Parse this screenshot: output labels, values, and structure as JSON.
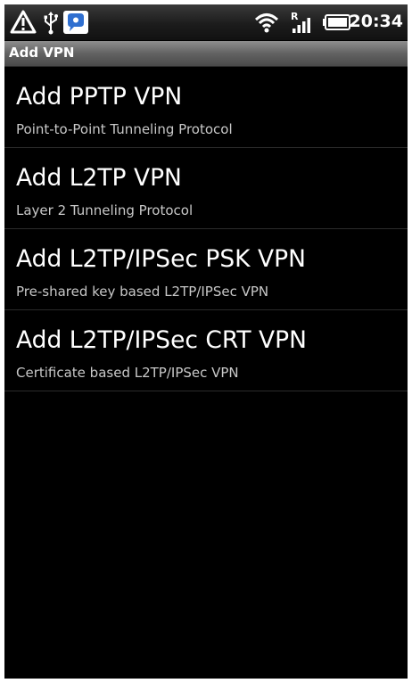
{
  "status_bar": {
    "time": "20:34",
    "icons": [
      "warning-icon",
      "usb-icon",
      "chat-notification-icon",
      "wifi-icon",
      "signal-roaming-icon",
      "battery-icon"
    ],
    "roaming_label": "R"
  },
  "title_bar": {
    "title": "Add VPN"
  },
  "vpn_options": [
    {
      "title": "Add PPTP VPN",
      "subtitle": "Point-to-Point Tunneling Protocol"
    },
    {
      "title": "Add L2TP VPN",
      "subtitle": "Layer 2 Tunneling Protocol"
    },
    {
      "title": "Add L2TP/IPSec PSK VPN",
      "subtitle": "Pre-shared key based L2TP/IPSec VPN"
    },
    {
      "title": "Add L2TP/IPSec CRT VPN",
      "subtitle": "Certificate based L2TP/IPSec VPN"
    }
  ],
  "colors": {
    "background": "#000000",
    "title_bar": "#626262",
    "text_primary": "#ffffff",
    "text_secondary": "#c8c8c8",
    "divider": "#2b2b2b"
  }
}
